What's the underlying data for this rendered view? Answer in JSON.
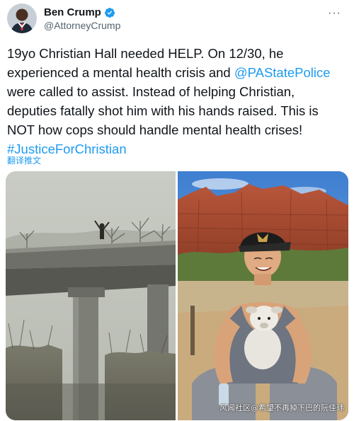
{
  "author": {
    "name": "Ben Crump",
    "handle": "@AttorneyCrump",
    "avatar_icon": "profile-photo",
    "verified_icon": "verified-badge-icon",
    "verified_color": "#1d9bf0"
  },
  "more_label": "···",
  "tweet": {
    "text_part1": "19yo Christian Hall needed HELP. On 12/30, he experienced a mental health crisis and ",
    "mention": "@PAStatePolice",
    "text_part2": " were called to assist. Instead of helping Christian, deputies fatally shot him with his hands raised. This is NOT how cops should handle mental health crises! ",
    "hashtag": "#JusticeForChristian",
    "link_color": "#1d9bf0"
  },
  "translate_label": "翻译推文",
  "media": {
    "left_image": "bridge-photo",
    "right_image": "christian-hall-photo",
    "watermark": "风闻社区@希望不再掉下巴的阮佳玮"
  }
}
